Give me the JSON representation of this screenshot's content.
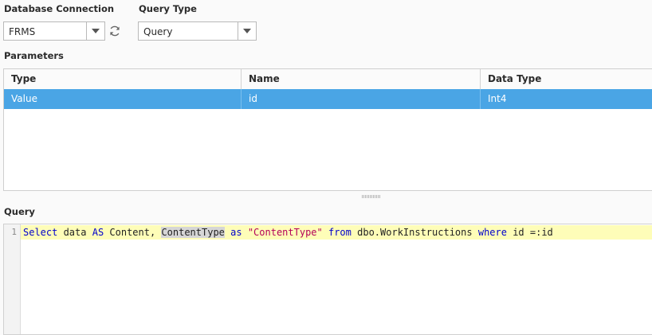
{
  "db_connection": {
    "label": "Database Connection",
    "value": "FRMS"
  },
  "query_type": {
    "label": "Query Type",
    "value": "Query"
  },
  "parameters": {
    "label": "Parameters",
    "columns": [
      "Type",
      "Name",
      "Data Type"
    ],
    "rows": [
      {
        "type": "Value",
        "name": "id",
        "data_type": "Int4"
      }
    ]
  },
  "query": {
    "label": "Query",
    "line_number": "1",
    "tokens": {
      "t1": "Select",
      "t2": " data ",
      "t3": "AS",
      "t4": " Content, ",
      "t5": "ContentType",
      "t6": " ",
      "t7": "as",
      "t8": " ",
      "t9": "\"ContentType\"",
      "t10": " ",
      "t11": "from",
      "t12": " dbo.WorkInstructions ",
      "t13": "where",
      "t14": " id =:id"
    }
  },
  "colors": {
    "selection": "#4aa5e5",
    "current_line": "#fefdb8",
    "keyword": "#0000cc",
    "string": "#b4005a"
  }
}
